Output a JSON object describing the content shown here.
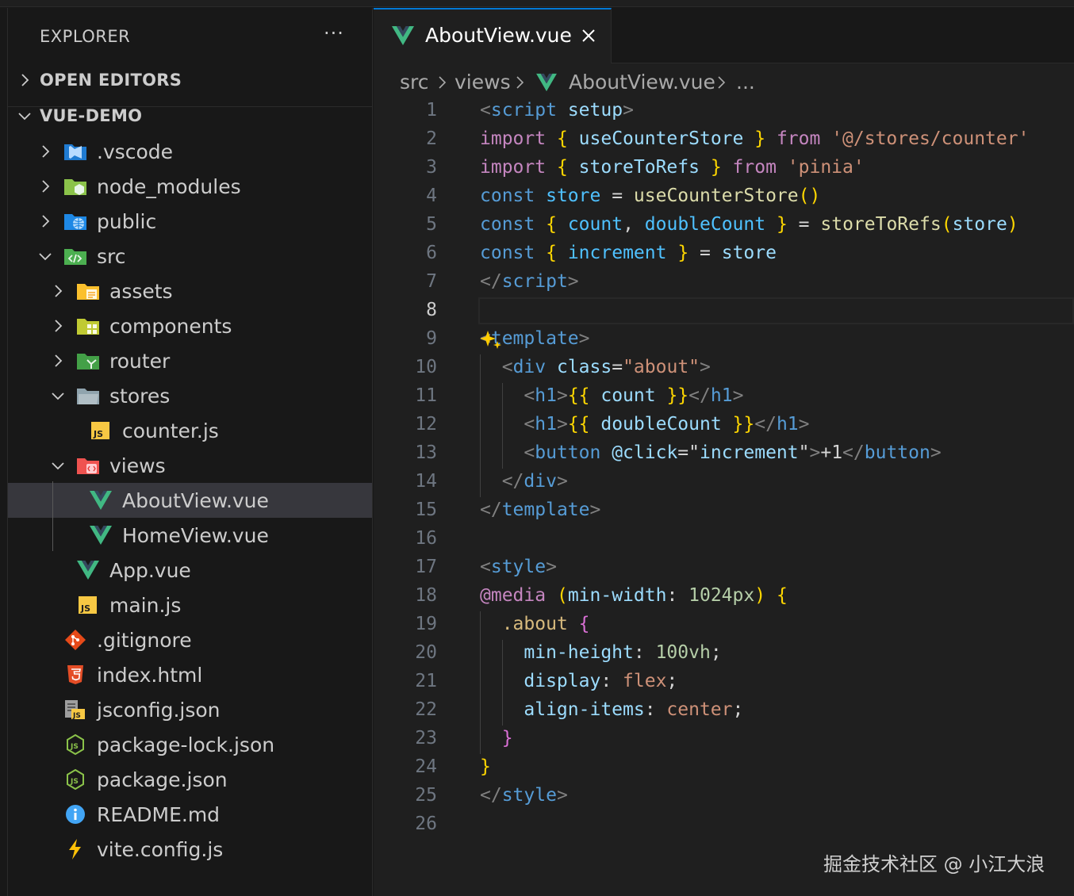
{
  "explorer": {
    "title": "EXPLORER",
    "more": "···",
    "sections": [
      {
        "label": "OPEN EDITORS",
        "expanded": false
      },
      {
        "label": "VUE-DEMO",
        "expanded": true
      }
    ],
    "tree": [
      {
        "name": ".vscode",
        "type": "folder",
        "icon": "vscode-folder-icon",
        "expanded": false,
        "depth": 1
      },
      {
        "name": "node_modules",
        "type": "folder",
        "icon": "node-folder-icon",
        "expanded": false,
        "depth": 1
      },
      {
        "name": "public",
        "type": "folder",
        "icon": "public-folder-icon",
        "expanded": false,
        "depth": 1
      },
      {
        "name": "src",
        "type": "folder",
        "icon": "src-folder-icon",
        "expanded": true,
        "depth": 1
      },
      {
        "name": "assets",
        "type": "folder",
        "icon": "assets-folder-icon",
        "expanded": false,
        "depth": 2
      },
      {
        "name": "components",
        "type": "folder",
        "icon": "components-folder-icon",
        "expanded": false,
        "depth": 2
      },
      {
        "name": "router",
        "type": "folder",
        "icon": "router-folder-icon",
        "expanded": false,
        "depth": 2
      },
      {
        "name": "stores",
        "type": "folder",
        "icon": "stores-folder-icon",
        "expanded": true,
        "depth": 2
      },
      {
        "name": "counter.js",
        "type": "file",
        "icon": "js-icon",
        "depth": 3
      },
      {
        "name": "views",
        "type": "folder",
        "icon": "views-folder-icon",
        "expanded": true,
        "depth": 2
      },
      {
        "name": "AboutView.vue",
        "type": "file",
        "icon": "vue-icon",
        "depth": 3,
        "active": true
      },
      {
        "name": "HomeView.vue",
        "type": "file",
        "icon": "vue-icon",
        "depth": 3
      },
      {
        "name": "App.vue",
        "type": "file",
        "icon": "vue-icon",
        "depth": 2
      },
      {
        "name": "main.js",
        "type": "file",
        "icon": "js-icon",
        "depth": 2
      },
      {
        "name": ".gitignore",
        "type": "file",
        "icon": "git-icon",
        "depth": 1
      },
      {
        "name": "index.html",
        "type": "file",
        "icon": "html5-icon",
        "depth": 1
      },
      {
        "name": "jsconfig.json",
        "type": "file",
        "icon": "jsconfig-icon",
        "depth": 1
      },
      {
        "name": "package-lock.json",
        "type": "file",
        "icon": "nodejs-icon",
        "depth": 1
      },
      {
        "name": "package.json",
        "type": "file",
        "icon": "nodejs-icon",
        "depth": 1
      },
      {
        "name": "README.md",
        "type": "file",
        "icon": "info-icon",
        "depth": 1
      },
      {
        "name": "vite.config.js",
        "type": "file",
        "icon": "vite-icon",
        "depth": 1
      }
    ]
  },
  "editor": {
    "tab": {
      "label": "AboutView.vue",
      "icon": "vue-icon"
    },
    "breadcrumbs": [
      "src",
      "views",
      "AboutView.vue",
      "..."
    ],
    "current_line": 8,
    "lines": [
      [
        [
          "<",
          "t-br"
        ],
        [
          "script",
          "t-tag"
        ],
        [
          " ",
          "t-pl"
        ],
        [
          "setup",
          "t-attr"
        ],
        [
          ">",
          "t-br"
        ]
      ],
      [
        [
          "import",
          "t-kw"
        ],
        [
          " ",
          "t-pl"
        ],
        [
          "{",
          "t-b1"
        ],
        [
          " useCounterStore ",
          "t-var"
        ],
        [
          "}",
          "t-b1"
        ],
        [
          " ",
          "t-pl"
        ],
        [
          "from",
          "t-kw"
        ],
        [
          " ",
          "t-pl"
        ],
        [
          "'@/stores/counter'",
          "t-str"
        ]
      ],
      [
        [
          "import",
          "t-kw"
        ],
        [
          " ",
          "t-pl"
        ],
        [
          "{",
          "t-b1"
        ],
        [
          " storeToRefs ",
          "t-var"
        ],
        [
          "}",
          "t-b1"
        ],
        [
          " ",
          "t-pl"
        ],
        [
          "from",
          "t-kw"
        ],
        [
          " ",
          "t-pl"
        ],
        [
          "'pinia'",
          "t-str"
        ]
      ],
      [
        [
          "const",
          "t-dec"
        ],
        [
          " ",
          "t-pl"
        ],
        [
          "store",
          "t-const"
        ],
        [
          " = ",
          "t-pl"
        ],
        [
          "useCounterStore",
          "t-fn"
        ],
        [
          "()",
          "t-b1"
        ]
      ],
      [
        [
          "const",
          "t-dec"
        ],
        [
          " ",
          "t-pl"
        ],
        [
          "{",
          "t-b1"
        ],
        [
          " ",
          "t-pl"
        ],
        [
          "count",
          "t-const"
        ],
        [
          ", ",
          "t-pl"
        ],
        [
          "doubleCount",
          "t-const"
        ],
        [
          " ",
          "t-pl"
        ],
        [
          "}",
          "t-b1"
        ],
        [
          " = ",
          "t-pl"
        ],
        [
          "storeToRefs",
          "t-fn"
        ],
        [
          "(",
          "t-b1"
        ],
        [
          "store",
          "t-var"
        ],
        [
          ")",
          "t-b1"
        ]
      ],
      [
        [
          "const",
          "t-dec"
        ],
        [
          " ",
          "t-pl"
        ],
        [
          "{",
          "t-b1"
        ],
        [
          " ",
          "t-pl"
        ],
        [
          "increment",
          "t-const"
        ],
        [
          " ",
          "t-pl"
        ],
        [
          "}",
          "t-b1"
        ],
        [
          " = ",
          "t-pl"
        ],
        [
          "store",
          "t-var"
        ]
      ],
      [
        [
          "</",
          "t-br"
        ],
        [
          "script",
          "t-tag"
        ],
        [
          ">",
          "t-br"
        ]
      ],
      [],
      [
        [
          "<",
          "t-br"
        ],
        [
          "template",
          "t-tag"
        ],
        [
          ">",
          "t-br"
        ]
      ],
      [
        [
          "  ",
          "t-pl"
        ],
        [
          "<",
          "t-br"
        ],
        [
          "div",
          "t-tag"
        ],
        [
          " ",
          "t-pl"
        ],
        [
          "class",
          "t-attr"
        ],
        [
          "=",
          "t-pl"
        ],
        [
          "\"about\"",
          "t-str"
        ],
        [
          ">",
          "t-br"
        ]
      ],
      [
        [
          "    ",
          "t-pl"
        ],
        [
          "<",
          "t-br"
        ],
        [
          "h1",
          "t-tag"
        ],
        [
          ">",
          "t-br"
        ],
        [
          "{{",
          "t-b1"
        ],
        [
          " count ",
          "t-var"
        ],
        [
          "}}",
          "t-b1"
        ],
        [
          "</",
          "t-br"
        ],
        [
          "h1",
          "t-tag"
        ],
        [
          ">",
          "t-br"
        ]
      ],
      [
        [
          "    ",
          "t-pl"
        ],
        [
          "<",
          "t-br"
        ],
        [
          "h1",
          "t-tag"
        ],
        [
          ">",
          "t-br"
        ],
        [
          "{{",
          "t-b1"
        ],
        [
          " doubleCount ",
          "t-var"
        ],
        [
          "}}",
          "t-b1"
        ],
        [
          "</",
          "t-br"
        ],
        [
          "h1",
          "t-tag"
        ],
        [
          ">",
          "t-br"
        ]
      ],
      [
        [
          "    ",
          "t-pl"
        ],
        [
          "<",
          "t-br"
        ],
        [
          "button",
          "t-tag"
        ],
        [
          " ",
          "t-pl"
        ],
        [
          "@click",
          "t-attr"
        ],
        [
          "=\"",
          "t-pl"
        ],
        [
          "increment",
          "t-var"
        ],
        [
          "\"",
          "t-pl"
        ],
        [
          ">",
          "t-br"
        ],
        [
          "+1",
          "t-pl"
        ],
        [
          "</",
          "t-br"
        ],
        [
          "button",
          "t-tag"
        ],
        [
          ">",
          "t-br"
        ]
      ],
      [
        [
          "  ",
          "t-pl"
        ],
        [
          "</",
          "t-br"
        ],
        [
          "div",
          "t-tag"
        ],
        [
          ">",
          "t-br"
        ]
      ],
      [
        [
          "</",
          "t-br"
        ],
        [
          "template",
          "t-tag"
        ],
        [
          ">",
          "t-br"
        ]
      ],
      [],
      [
        [
          "<",
          "t-br"
        ],
        [
          "style",
          "t-tag"
        ],
        [
          ">",
          "t-br"
        ]
      ],
      [
        [
          "@media",
          "t-kw"
        ],
        [
          " ",
          "t-pl"
        ],
        [
          "(",
          "t-b1"
        ],
        [
          "min-width",
          "t-prop"
        ],
        [
          ": ",
          "t-pl"
        ],
        [
          "1024px",
          "t-num"
        ],
        [
          ")",
          "t-b1"
        ],
        [
          " ",
          "t-pl"
        ],
        [
          "{",
          "t-b1"
        ]
      ],
      [
        [
          "  ",
          "t-pl"
        ],
        [
          ".about",
          "t-sel"
        ],
        [
          " ",
          "t-pl"
        ],
        [
          "{",
          "t-b2"
        ]
      ],
      [
        [
          "    ",
          "t-pl"
        ],
        [
          "min-height",
          "t-prop"
        ],
        [
          ": ",
          "t-pl"
        ],
        [
          "100vh",
          "t-num"
        ],
        [
          ";",
          "t-pl"
        ]
      ],
      [
        [
          "    ",
          "t-pl"
        ],
        [
          "display",
          "t-prop"
        ],
        [
          ": ",
          "t-pl"
        ],
        [
          "flex",
          "t-val"
        ],
        [
          ";",
          "t-pl"
        ]
      ],
      [
        [
          "    ",
          "t-pl"
        ],
        [
          "align-items",
          "t-prop"
        ],
        [
          ": ",
          "t-pl"
        ],
        [
          "center",
          "t-val"
        ],
        [
          ";",
          "t-pl"
        ]
      ],
      [
        [
          "  ",
          "t-pl"
        ],
        [
          "}",
          "t-b2"
        ]
      ],
      [
        [
          "}",
          "t-b1"
        ]
      ],
      [
        [
          "</",
          "t-br"
        ],
        [
          "style",
          "t-tag"
        ],
        [
          ">",
          "t-br"
        ]
      ],
      []
    ]
  },
  "watermark": "掘金技术社区 @ 小江大浪"
}
